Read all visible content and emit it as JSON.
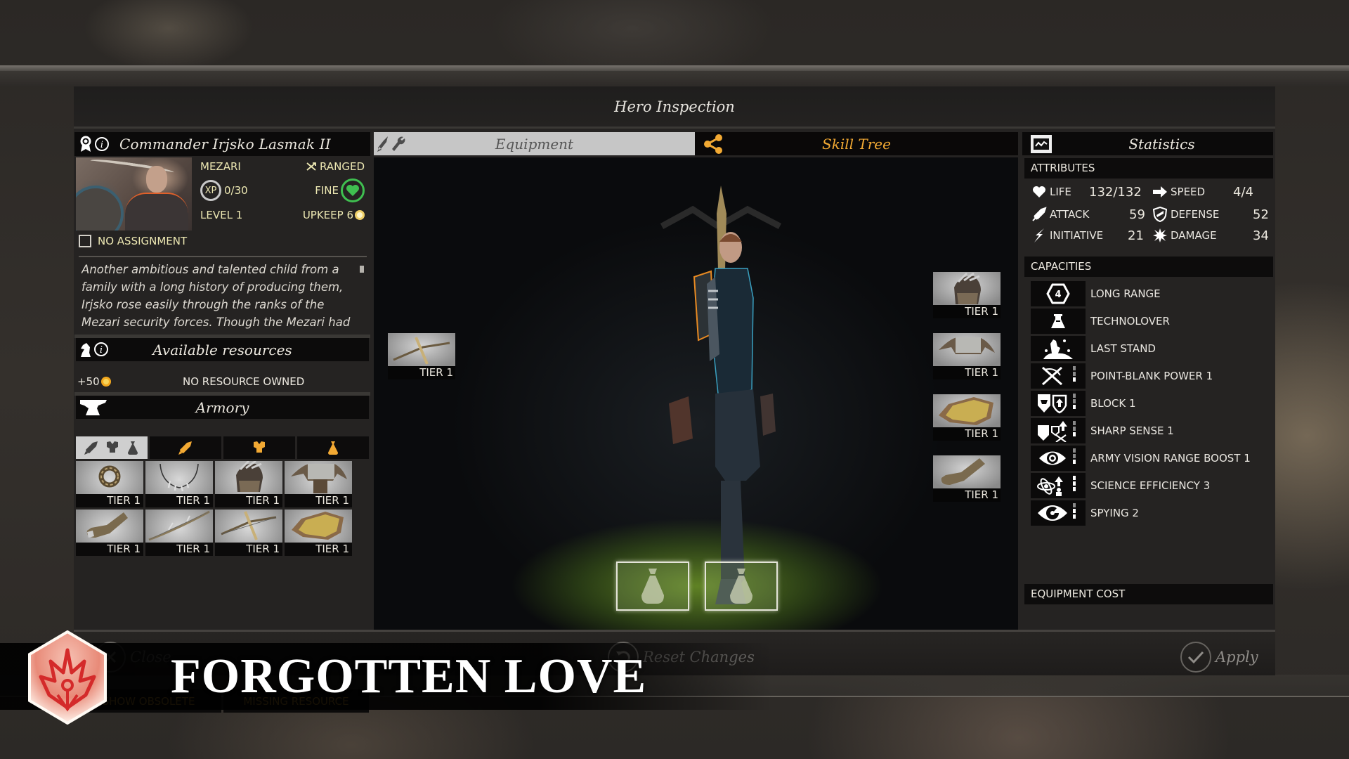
{
  "modal": {
    "title": "Hero Inspection"
  },
  "hero": {
    "name": "Commander Irjsko Lasmak II",
    "faction": "MEZARI",
    "class": "RANGED",
    "xp_label": "XP",
    "xp": "0/30",
    "health_status": "FINE",
    "level": "LEVEL 1",
    "upkeep": "UPKEEP 6",
    "assignment": "NO ASSIGNMENT",
    "assignment_checked": false,
    "description": "Another ambitious and talented child from a family with a long history of producing them, Irjsko rose easily through the ranks of the Mezari security forces. Though the Mezari had only seen the fall of Auriga, she felt the same"
  },
  "resources": {
    "title": "Available resources",
    "bonus": "+50",
    "status": "NO RESOURCE OWNED"
  },
  "armory": {
    "title": "Armory",
    "filters": [
      {
        "name": "all",
        "icons": [
          "sword-icon",
          "armor-icon",
          "bag-icon"
        ],
        "active": true
      },
      {
        "name": "weapons",
        "icons": [
          "sword-icon"
        ],
        "active": false
      },
      {
        "name": "armor",
        "icons": [
          "armor-icon"
        ],
        "active": false
      },
      {
        "name": "accessories",
        "icons": [
          "bag-icon"
        ],
        "active": false
      }
    ],
    "items": [
      {
        "kind": "ring",
        "tier": "TIER 1"
      },
      {
        "kind": "necklace",
        "tier": "TIER 1"
      },
      {
        "kind": "helmet",
        "tier": "TIER 1"
      },
      {
        "kind": "shoulder-armor",
        "tier": "TIER 1"
      },
      {
        "kind": "boots",
        "tier": "TIER 1"
      },
      {
        "kind": "bow",
        "tier": "TIER 1"
      },
      {
        "kind": "crossbow",
        "tier": "TIER 1"
      },
      {
        "kind": "chest-plate",
        "tier": "TIER 1"
      }
    ],
    "show_obsolete": "SHOW OBSOLETE",
    "missing_resource": "MISSING RESOURCE"
  },
  "tabs": {
    "equipment": "Equipment",
    "skill_tree": "Skill Tree",
    "active": "equipment"
  },
  "equipped": {
    "weapon": {
      "kind": "crossbow",
      "tier": "TIER 1"
    },
    "helmet": {
      "kind": "helmet",
      "tier": "TIER 1"
    },
    "shoulders": {
      "kind": "shoulder-armor",
      "tier": "TIER 1"
    },
    "chest": {
      "kind": "chest-plate",
      "tier": "TIER 1"
    },
    "boots": {
      "kind": "boots",
      "tier": "TIER 1"
    },
    "accessory_slots": [
      "empty",
      "empty"
    ]
  },
  "statistics": {
    "title": "Statistics",
    "attributes_label": "ATTRIBUTES",
    "attributes": {
      "life": {
        "label": "LIFE",
        "value": "132/132"
      },
      "attack": {
        "label": "ATTACK",
        "value": "59"
      },
      "initiative": {
        "label": "INITIATIVE",
        "value": "21"
      },
      "speed": {
        "label": "SPEED",
        "value": "4/4"
      },
      "defense": {
        "label": "DEFENSE",
        "value": "52"
      },
      "damage": {
        "label": "DAMAGE",
        "value": "34"
      }
    },
    "capacities_label": "CAPACITIES",
    "capacities": [
      {
        "name": "LONG RANGE",
        "icon": "range-hexagon-icon",
        "icon_text": "4",
        "level": 0,
        "max": 0
      },
      {
        "name": "TECHNOLOVER",
        "icon": "flask-icon",
        "level": 0,
        "max": 0
      },
      {
        "name": "LAST STAND",
        "icon": "last-stand-icon",
        "level": 0,
        "max": 0
      },
      {
        "name": "POINT-BLANK POWER 1",
        "icon": "point-blank-icon",
        "level": 1,
        "max": 3
      },
      {
        "name": "BLOCK 1",
        "icon": "block-icon",
        "level": 1,
        "max": 3
      },
      {
        "name": "SHARP SENSE 1",
        "icon": "sharp-sense-icon",
        "level": 1,
        "max": 3
      },
      {
        "name": "ARMY VISION RANGE BOOST 1",
        "icon": "eye-icon",
        "level": 1,
        "max": 3
      },
      {
        "name": "SCIENCE EFFICIENCY 3",
        "icon": "science-icon",
        "level": 3,
        "max": 3
      },
      {
        "name": "SPYING 2",
        "icon": "spy-eye-icon",
        "level": 2,
        "max": 3
      }
    ],
    "equipment_cost_label": "EQUIPMENT COST"
  },
  "footer": {
    "close": "Close",
    "reset": "Reset Changes",
    "apply": "Apply"
  },
  "banner": {
    "title": "FORGOTTEN LOVE"
  },
  "colors": {
    "accent_orange": "#f2a933",
    "stat_yellow": "#ede8b3",
    "health_green": "#3fbf50",
    "emblem_red": "#d42a2a"
  }
}
